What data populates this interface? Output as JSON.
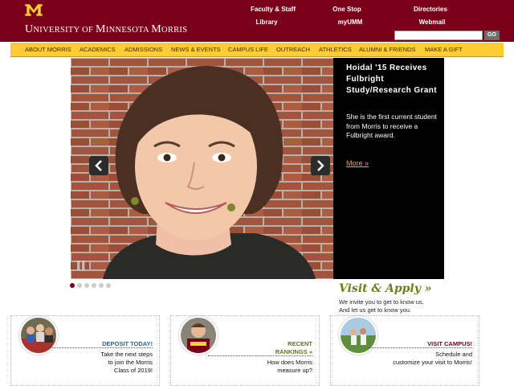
{
  "brand": {
    "logo_letter": "M",
    "wordmark_parts": [
      {
        "text": "U",
        "big": true
      },
      {
        "text": "NIVERSITY OF ",
        "big": false
      },
      {
        "text": "M",
        "big": true
      },
      {
        "text": "INNESOTA ",
        "big": false
      },
      {
        "text": "M",
        "big": true
      },
      {
        "text": "ORRIS",
        "big": false
      }
    ]
  },
  "utility_links": [
    {
      "label": "Faculty & Staff"
    },
    {
      "label": "One Stop"
    },
    {
      "label": "Directories"
    },
    {
      "label": "Library"
    },
    {
      "label": "myUMM"
    },
    {
      "label": "Webmail"
    }
  ],
  "search": {
    "value": "",
    "button_label": "GO"
  },
  "nav": [
    {
      "label": "ABOUT MORRIS"
    },
    {
      "label": "ACADEMICS"
    },
    {
      "label": "ADMISSIONS"
    },
    {
      "label": "NEWS & EVENTS"
    },
    {
      "label": "CAMPUS LIFE"
    },
    {
      "label": "OUTREACH"
    },
    {
      "label": "ATHLETICS"
    },
    {
      "label": "ALUMNI & FRIENDS"
    },
    {
      "label": "MAKE A GIFT"
    }
  ],
  "hero": {
    "title": "Hoidal '15 Receives Fulbright Study/Research Grant",
    "text": "She is the first current student from Morris to receive a Fulbright award.",
    "link": "More »",
    "prev_icon": "chevron-left-icon",
    "next_icon": "chevron-right-icon",
    "pause_icon": "pause-icon"
  },
  "slider": {
    "count": 6,
    "active": 1
  },
  "visit": {
    "title": "Visit & Apply »",
    "lines": [
      "We invite you to get to know us.",
      "And let us get to know you."
    ]
  },
  "boxes": [
    {
      "title_lines": [
        "DEPOSIT TODAY!"
      ],
      "text": [
        "Take the next steps",
        "to join the Morris",
        "Class of 2019!"
      ],
      "title_color": "#2a64a8"
    },
    {
      "title_lines": [
        "RECENT",
        "RANKINGS »"
      ],
      "text": [
        "How does Morris",
        "measure up?"
      ],
      "title_color": "#5d7a14"
    },
    {
      "title_lines": [
        "VISIT CAMPUS!"
      ],
      "text": [
        "Schedule and",
        "customize your visit to Morris!"
      ],
      "title_color": "#7a0019"
    }
  ],
  "colors": {
    "maroon": "#7a0019",
    "gold": "#ffcc33"
  }
}
